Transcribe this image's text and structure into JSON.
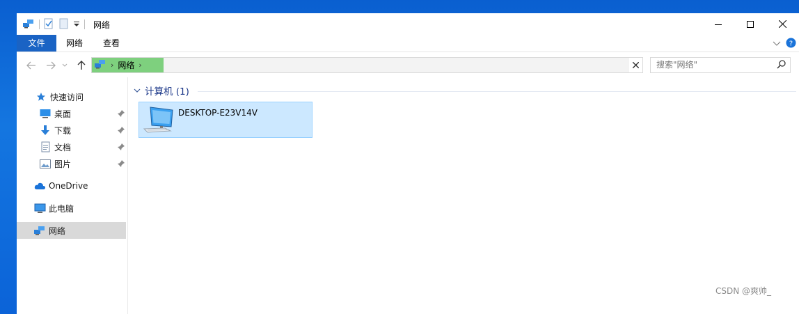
{
  "window": {
    "title": "网络"
  },
  "ribbon": {
    "tabs": [
      "文件",
      "网络",
      "查看"
    ]
  },
  "address": {
    "location": "网络",
    "search_placeholder": "搜索\"网络\""
  },
  "navpane": {
    "quick_access": "快速访问",
    "quick_items": [
      "桌面",
      "下载",
      "文档",
      "图片"
    ],
    "onedrive": "OneDrive",
    "this_pc": "此电脑",
    "network": "网络"
  },
  "content": {
    "group_title": "计算机 (1)",
    "items": [
      {
        "name": "DESKTOP-E23V14V"
      }
    ]
  },
  "watermark": "CSDN @爽帅_",
  "colors": {
    "accent": "#1a63c4",
    "selection": "#cce8ff",
    "address_highlight": "#7ed07e"
  }
}
